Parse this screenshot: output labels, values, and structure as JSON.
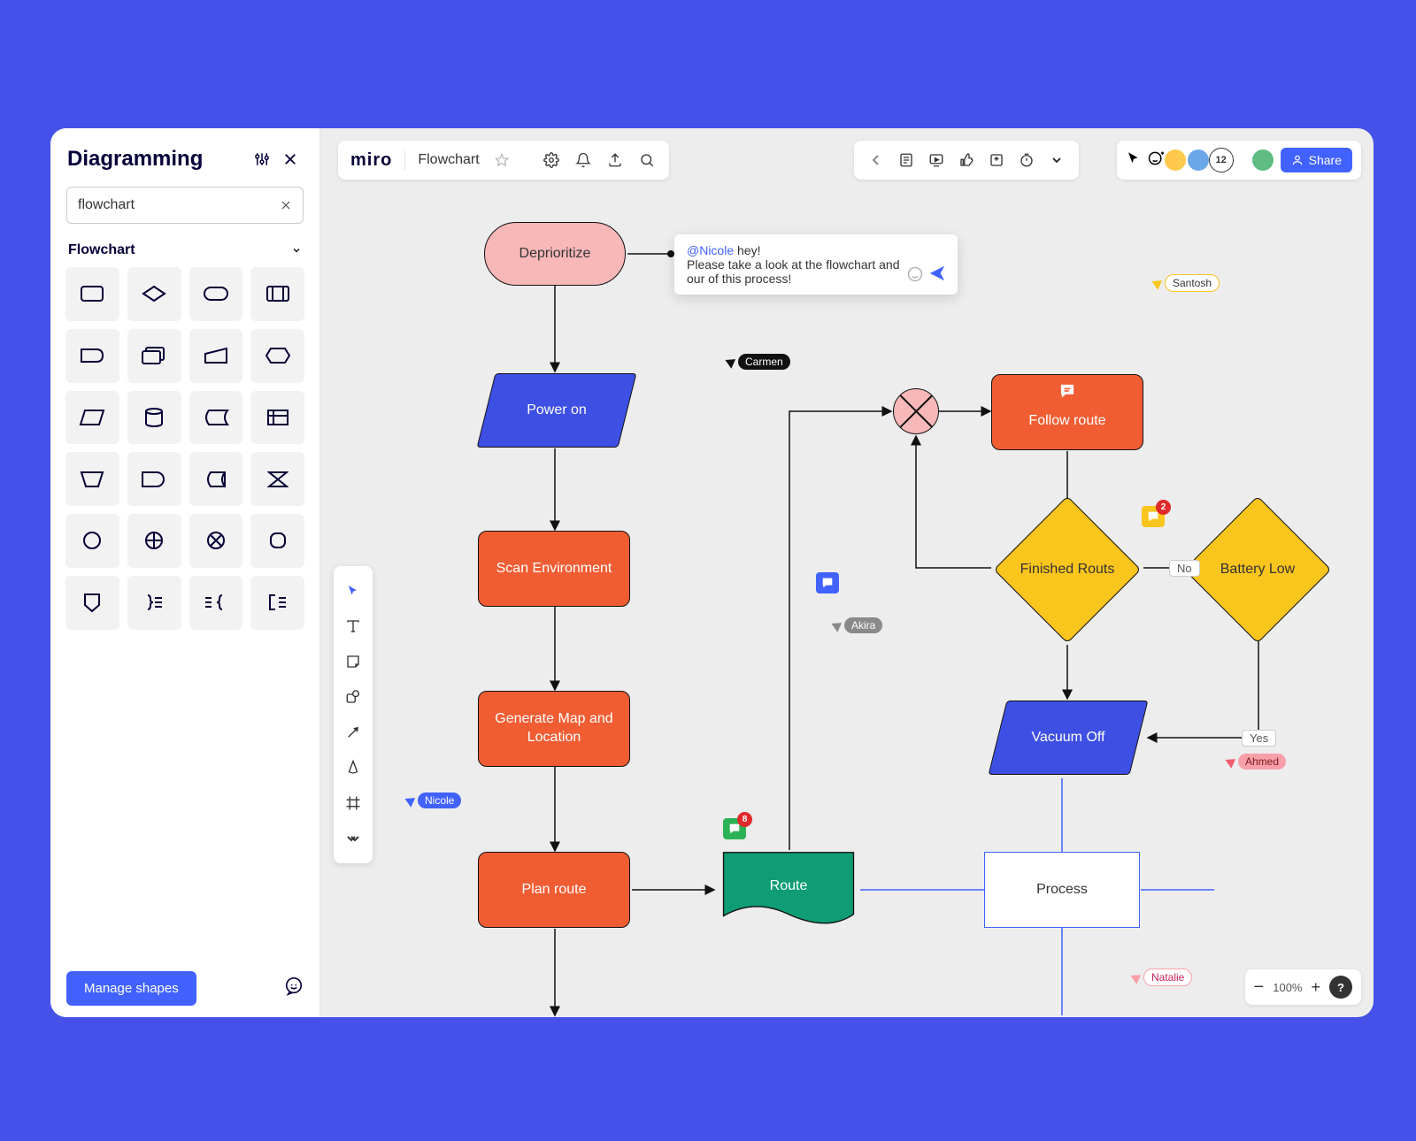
{
  "sidebar": {
    "title": "Diagramming",
    "search_value": "flowchart",
    "category": "Flowchart",
    "manage_btn": "Manage shapes",
    "shapes": [
      "rect-rounded",
      "decision",
      "terminator",
      "predefined",
      "display",
      "offpage",
      "manual-input",
      "prep",
      "data",
      "database",
      "stored-data",
      "internal-storage",
      "manual-op",
      "delay-shape",
      "stored-disk",
      "collate",
      "circle",
      "summing",
      "or-gate",
      "connector2",
      "offpage2",
      "brace-right",
      "brace-both",
      "note"
    ]
  },
  "topbar": {
    "logo": "miro",
    "board_title": "Flowchart"
  },
  "presence": {
    "overflow_count": "12"
  },
  "share_btn": "Share",
  "zoom": {
    "level": "100%"
  },
  "comment": {
    "mention": "@Nicole",
    "line1": " hey!",
    "line2": "Please take a look at the flowchart and our of this process!"
  },
  "cursors": {
    "nicole": "Nicole",
    "carmen": "Carmen",
    "akira": "Akira",
    "santosh": "Santosh",
    "ahmed": "Ahmed",
    "natalie": "Natalie"
  },
  "badges": {
    "green_count": "8",
    "yellow_count": "2"
  },
  "nodes": {
    "deprioritize": "Deprioritize",
    "power_on": "Power on",
    "scan_env": "Scan Environment",
    "gen_map": "Generate Map and Location",
    "plan_route": "Plan route",
    "route": "Route",
    "process": "Process",
    "follow_route": "Follow route",
    "finished_routs": "Finished Routs",
    "battery_low": "Battery Low",
    "vacuum_off": "Vacuum Off"
  },
  "edge_labels": {
    "no": "No",
    "yes": "Yes"
  }
}
